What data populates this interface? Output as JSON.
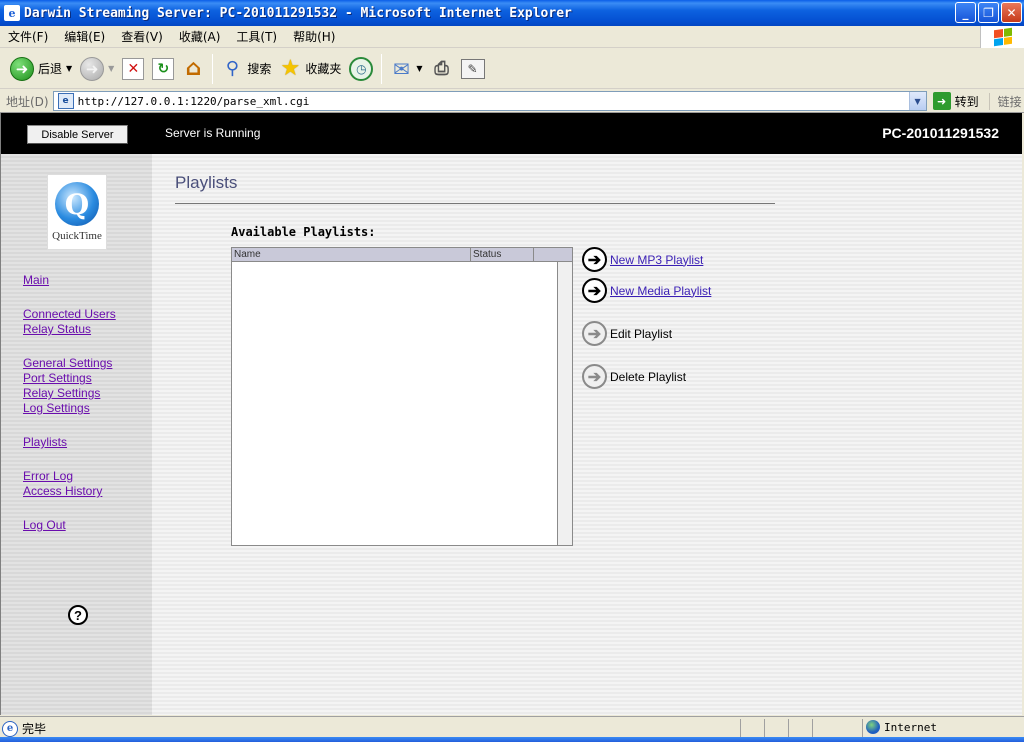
{
  "window": {
    "title": "Darwin Streaming Server: PC-201011291532 - Microsoft Internet Explorer",
    "app_icon": "e",
    "controls": {
      "minimize": "_",
      "maximize": "❐",
      "close": "✕"
    }
  },
  "menu": [
    "文件(F)",
    "编辑(E)",
    "查看(V)",
    "收藏(A)",
    "工具(T)",
    "帮助(H)"
  ],
  "toolbar": {
    "back_label": "后退",
    "search_label": "搜索",
    "favorites_label": "收藏夹",
    "icons": [
      "back-icon",
      "forward-icon",
      "stop-icon",
      "refresh-icon",
      "home-icon",
      "search-icon",
      "favorites-icon",
      "history-icon",
      "mail-icon",
      "print-icon",
      "edit-icon"
    ]
  },
  "addressbar": {
    "label": "地址(D)",
    "url": "http://127.0.0.1:1220/parse_xml.cgi",
    "go_label": "转到",
    "links_label": "链接"
  },
  "header": {
    "disable_button": "Disable Server",
    "status": "Server is Running",
    "host": "PC-201011291532"
  },
  "sidebar": {
    "logo_text": "QuickTime",
    "items": [
      {
        "label": "Main"
      },
      {
        "label": "Connected Users"
      },
      {
        "label": "Relay Status"
      },
      {
        "label": "General Settings"
      },
      {
        "label": "Port Settings"
      },
      {
        "label": "Relay Settings"
      },
      {
        "label": "Log Settings"
      },
      {
        "label": "Playlists"
      },
      {
        "label": "Error Log"
      },
      {
        "label": "Access History"
      },
      {
        "label": "Log Out"
      }
    ],
    "help": "?"
  },
  "main": {
    "title": "Playlists",
    "available_label": "Available Playlists:",
    "table": {
      "columns": [
        "Name",
        "Status",
        ""
      ],
      "rows": []
    },
    "actions": [
      {
        "label": "New MP3 Playlist",
        "enabled": true
      },
      {
        "label": "New Media Playlist",
        "enabled": true
      },
      {
        "label": "Edit Playlist",
        "enabled": false
      },
      {
        "label": "Delete Playlist",
        "enabled": false
      }
    ]
  },
  "statusbar": {
    "done": "完毕",
    "zone": "Internet"
  }
}
